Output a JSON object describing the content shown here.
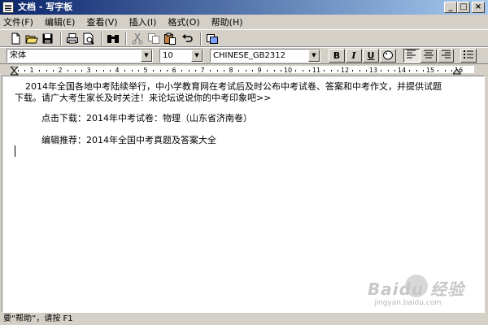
{
  "window": {
    "title": "文档 - 写字板",
    "minimize": "_",
    "maximize": "□",
    "close": "×"
  },
  "menu": [
    "文件(F)",
    "编辑(E)",
    "查看(V)",
    "插入(I)",
    "格式(O)",
    "帮助(H)"
  ],
  "toolbar": {
    "icons": [
      "new-document-icon",
      "open-folder-icon",
      "save-disk-icon",
      "print-icon",
      "print-preview-icon",
      "find-binoculars-icon",
      "cut-scissors-icon",
      "copy-icon",
      "paste-icon",
      "undo-icon",
      "insert-datetime-icon"
    ]
  },
  "format": {
    "font_name": "宋体",
    "font_size": "10",
    "script": "CHINESE_GB2312",
    "bold": "B",
    "italic": "I",
    "underline": "U",
    "align_left_active": true
  },
  "ruler": {
    "numbers": [
      "1",
      "2",
      "3",
      "4",
      "5",
      "6",
      "7",
      "8",
      "9",
      "10",
      "11",
      "12",
      "13",
      "14",
      "15",
      "16"
    ]
  },
  "document": {
    "lines": [
      "2014年全国各地中考陆续举行，中小学教育网在考试后及时公布中考试卷、答案和中考作文，并提供试题",
      "下载。请广大考生家长及时关注！来论坛说说你的中考印象吧>>",
      "点击下载：2014年中考试卷：物理（山东省济南卷）",
      "编辑推荐：2014年全国中考真题及答案大全"
    ]
  },
  "status": {
    "text": "要“帮助”，请按 F1"
  },
  "watermark": {
    "text": "Baidu 经验",
    "url": "jingyan.baidu.com"
  },
  "colors": {
    "title_start": "#0a246a",
    "title_end": "#a6caf0",
    "face": "#d4d0c8"
  }
}
